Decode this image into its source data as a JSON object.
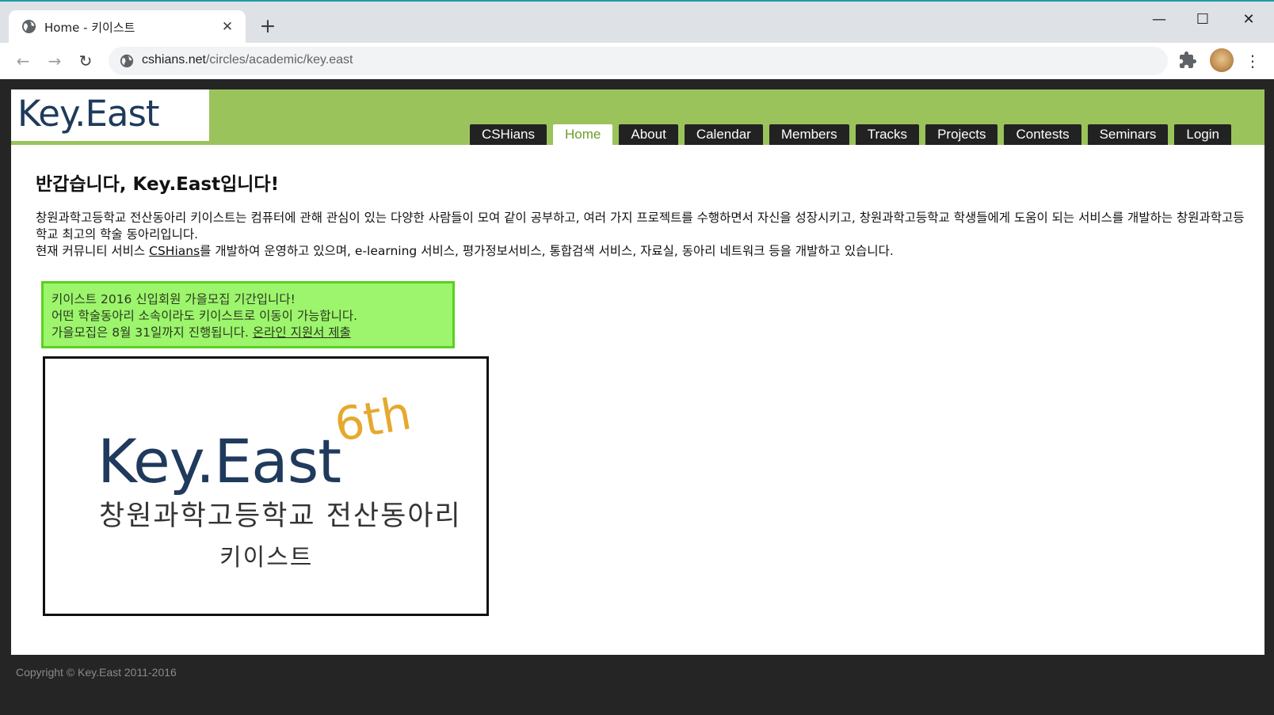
{
  "browser": {
    "tab_title": "Home - 키이스트",
    "url_host": "cshians.net",
    "url_path": "/circles/academic/key.east"
  },
  "site": {
    "logo_text": "Key.East",
    "nav": [
      {
        "label": "CSHians"
      },
      {
        "label": "Home",
        "active": true
      },
      {
        "label": "About"
      },
      {
        "label": "Calendar"
      },
      {
        "label": "Members"
      },
      {
        "label": "Tracks"
      },
      {
        "label": "Projects"
      },
      {
        "label": "Contests"
      },
      {
        "label": "Seminars"
      },
      {
        "label": "Login"
      }
    ],
    "accent_color": "#9bc35c"
  },
  "main": {
    "heading": "반갑습니다, Key.East입니다!",
    "intro_line1": "창원과학고등학교 전산동아리 키이스트는 컴퓨터에 관해 관심이 있는 다양한 사람들이 모여 같이 공부하고, 여러 가지 프로젝트를 수행하면서 자신을 성장시키고, 창원과학고등학교 학생들에게 도움이 되는 서비스를 개발하는 창원과학고등학교 최고의 학술 동아리입니다.",
    "intro_line2_prefix": "현재 커뮤니티 서비스 ",
    "intro_line2_link": "CSHians",
    "intro_line2_suffix": "를 개발하여 운영하고 있으며, e-learning 서비스, 평가정보서비스, 통합검색 서비스, 자료실, 동아리 네트워크 등을 개발하고 있습니다.",
    "notice": {
      "line1": "키이스트 2016 신입회원 가을모집 기간입니다!",
      "line2": "어떤 학술동아리 소속이라도 키이스트로 이동이 가능합니다.",
      "line3_prefix": "가을모집은 8월 31일까지 진행됩니다. ",
      "line3_link": "온라인 지원서 제출"
    },
    "banner": {
      "title": "Key.East",
      "edition": "6th",
      "subtitle": "창원과학고등학교 전산동아리",
      "subtitle2": "키이스트"
    }
  },
  "footer": {
    "copyright": "Copyright © Key.East 2011-2016"
  }
}
